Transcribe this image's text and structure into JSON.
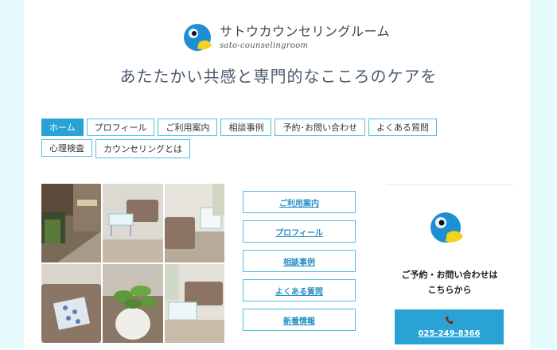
{
  "header": {
    "logo_jp": "サトウカウンセリングルーム",
    "logo_en": "sato-counselingroom",
    "tagline": "あたたかい共感と専門的なこころのケアを"
  },
  "nav": {
    "items": [
      {
        "label": "ホーム",
        "active": true
      },
      {
        "label": "プロフィール"
      },
      {
        "label": "ご利用案内"
      },
      {
        "label": "相談事例"
      },
      {
        "label": "予約･お問い合わせ"
      },
      {
        "label": "よくある質問"
      },
      {
        "label": "心理検査"
      },
      {
        "label": "カウンセリングとは"
      }
    ]
  },
  "links": [
    "ご利用案内",
    "プロフィール",
    "相談事例",
    "よくある質問",
    "新着情報"
  ],
  "contact": {
    "line1": "ご予約・お問い合わせは",
    "line2": "こちらから",
    "phone": "025-249-8366",
    "icon": "phone-icon"
  },
  "colors": {
    "accent": "#29a3d6",
    "border": "#52bee0",
    "side_tint": "#e6fbfb",
    "logo_blue": "#1e8fd2",
    "logo_yellow": "#f2d21b"
  }
}
